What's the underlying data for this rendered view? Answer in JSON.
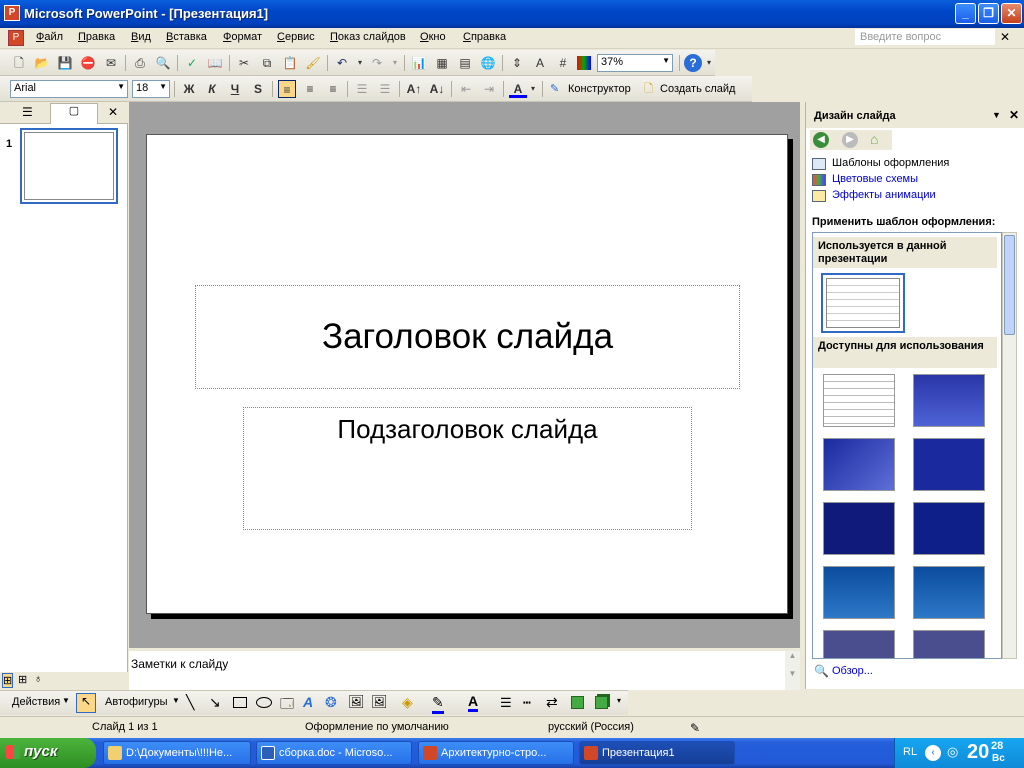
{
  "app": {
    "title": "Microsoft PowerPoint - [Презентация1]"
  },
  "menu": {
    "items": [
      "Файл",
      "Правка",
      "Вид",
      "Вставка",
      "Формат",
      "Сервис",
      "Показ слайдов",
      "Окно",
      "Справка"
    ],
    "ask_placeholder": "Введите вопрос"
  },
  "toolbar": {
    "zoom": "37%",
    "font": "Arial",
    "font_size": "18",
    "bold": "Ж",
    "italic": "К",
    "underline": "Ч",
    "shadow": "S",
    "designer": "Конструктор",
    "new_slide": "Создать слайд"
  },
  "left_pane": {
    "slide_number": "1"
  },
  "slide": {
    "title": "Заголовок слайда",
    "subtitle": "Подзаголовок слайда"
  },
  "notes": {
    "placeholder": "Заметки к слайду"
  },
  "task_pane": {
    "title": "Дизайн слайда",
    "links": [
      "Шаблоны оформления",
      "Цветовые схемы",
      "Эффекты анимации"
    ],
    "apply_label": "Применить шаблон оформления:",
    "section_used": "Используется в данной презентации",
    "section_available": "Доступны для использования",
    "browse": "Обзор..."
  },
  "drawing": {
    "actions": "Действия",
    "autoshapes": "Автофигуры"
  },
  "status": {
    "slide": "Слайд 1 из 1",
    "design": "Оформление по умолчанию",
    "language": "русский (Россия)"
  },
  "taskbar": {
    "start": "пуск",
    "tasks": [
      "D:\\Документы\\!!!Не...",
      "сборка.doc - Microso...",
      "Архитектурно-стро...",
      "Презентация1"
    ],
    "lang": "RL",
    "time": "20",
    "time_sup": "28",
    "day": "Вс"
  },
  "colors": {
    "accent": "#0054e3",
    "link": "#0000cc",
    "template_blue": "#1a2a9e"
  },
  "icons": [
    "new-icon",
    "open-icon",
    "save-icon",
    "print-icon",
    "cut-icon",
    "copy-icon",
    "paste-icon",
    "undo-icon",
    "redo-icon",
    "help-icon",
    "back-icon",
    "forward-icon",
    "home-icon"
  ]
}
